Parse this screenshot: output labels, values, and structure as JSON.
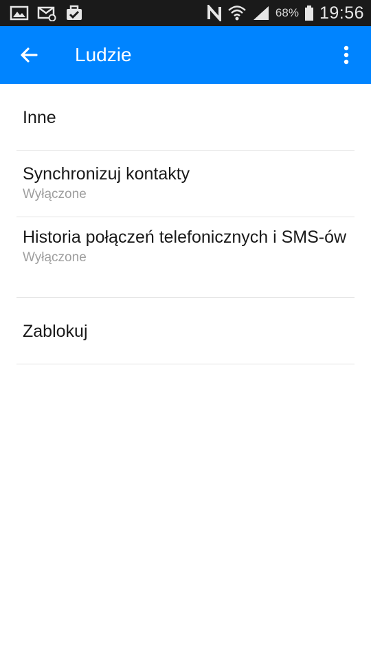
{
  "status_bar": {
    "battery_percent": "68%",
    "time": "19:56",
    "icons": [
      "image-icon",
      "email-icon",
      "briefcase-check-icon",
      "nfc-icon",
      "wifi-icon",
      "signal-icon",
      "battery-icon"
    ]
  },
  "app_bar": {
    "title": "Ludzie",
    "color": "#0084ff",
    "back_icon": "arrow-left-icon",
    "menu_icon": "more-vert-icon"
  },
  "settings": {
    "items": [
      {
        "title": "Inne"
      },
      {
        "title": "Synchronizuj kontakty",
        "subtitle": "Wyłączone"
      },
      {
        "title": "Historia połączeń telefonicznych i SMS-ów",
        "subtitle": "Wyłączone"
      },
      {
        "title": "Zablokuj"
      }
    ]
  }
}
